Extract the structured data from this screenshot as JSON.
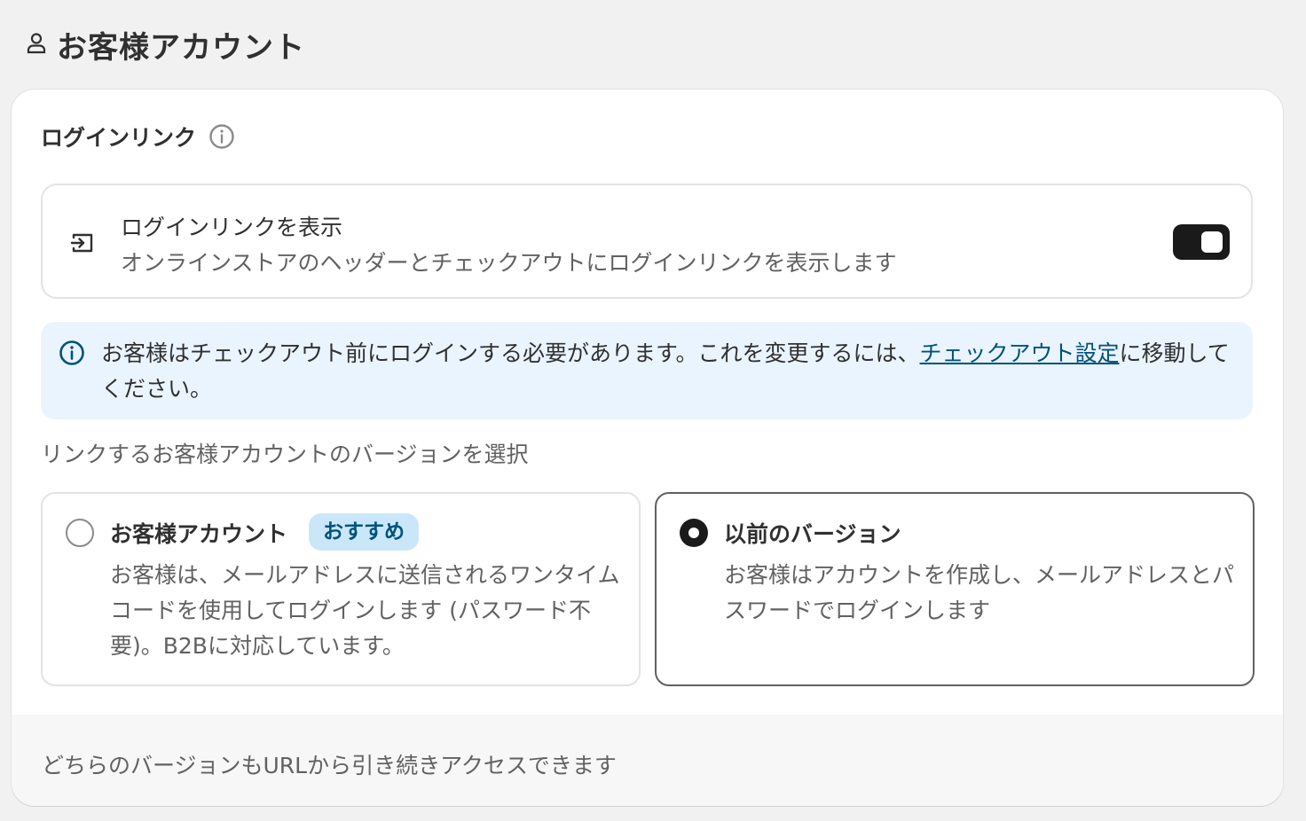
{
  "page": {
    "title": "お客様アカウント",
    "icon": "person-icon"
  },
  "login_link_section": {
    "title": "ログインリンク",
    "info_icon": "info-circle-icon",
    "toggle_row": {
      "icon": "login-arrow-icon",
      "title": "ログインリンクを表示",
      "description": "オンラインストアのヘッダーとチェックアウトにログインリンクを表示します",
      "enabled": true
    },
    "banner": {
      "icon": "info-circle-icon",
      "text_before": "お客様はチェックアウト前にログインする必要があります。これを変更するには、",
      "link_text": "チェックアウト設定",
      "text_after": "に移動してください。",
      "background": "#eaf4ff"
    },
    "select_label": "リンクするお客様アカウントのバージョンを選択",
    "options": [
      {
        "title": "お客様アカウント",
        "badge": "おすすめ",
        "description": "お客様は、メールアドレスに送信されるワンタイムコードを使用してログインします (パスワード不要)。B2Bに対応しています。",
        "selected": false
      },
      {
        "title": "以前のバージョン",
        "description": "お客様はアカウントを作成し、メールアドレスとパスワードでログインします",
        "selected": true
      }
    ],
    "footer_text": "どちらのバージョンもURLから引き続きアクセスできます"
  },
  "colors": {
    "page_bg": "#f1f1f1",
    "card_bg": "#ffffff",
    "toggle_on": "#1a1a1a",
    "banner_bg": "#eaf4ff",
    "badge_bg": "#cae7f9",
    "link": "#00527c"
  }
}
